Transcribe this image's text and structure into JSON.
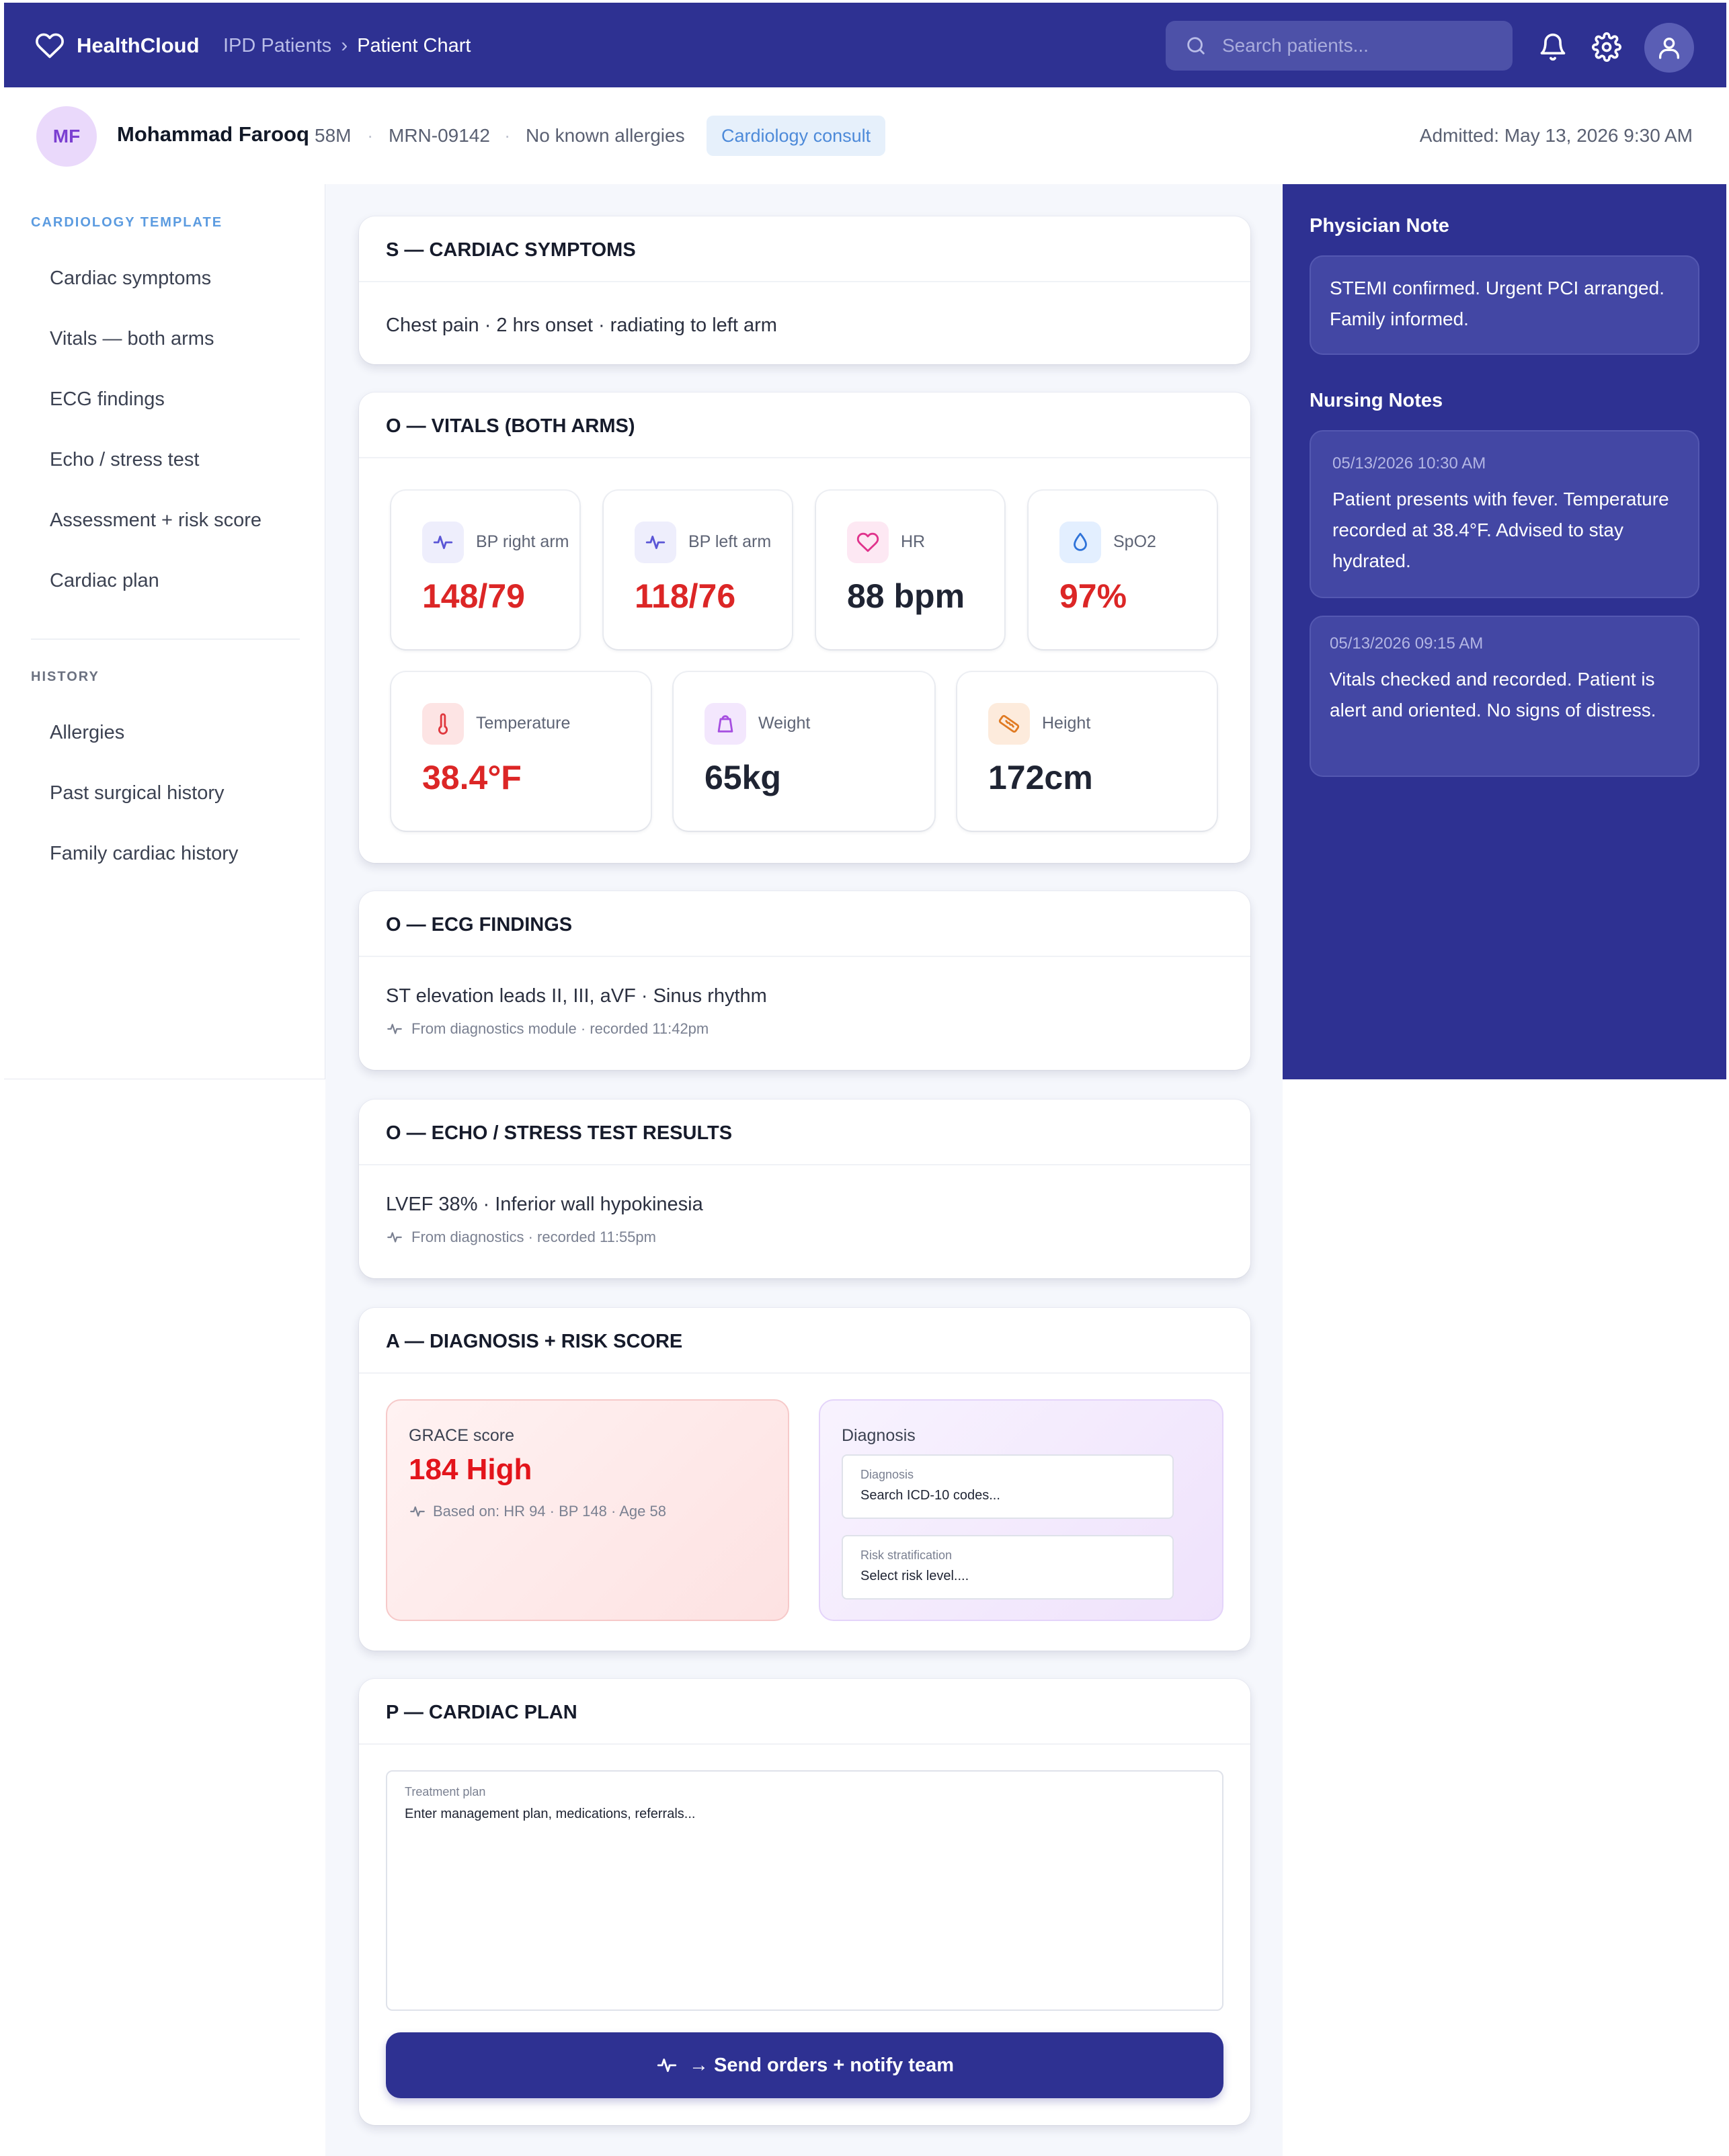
{
  "app": {
    "name": "HealthCloud",
    "breadcrumb": [
      "IPD Patients",
      "Patient Chart"
    ],
    "search_placeholder": "Search patients...",
    "brand_color": "#2e3192"
  },
  "patient": {
    "initials": "MF",
    "name": "Mohammad Farooq",
    "age_sex": "58M",
    "mrn": "MRN-09142",
    "allergies": "No known allergies",
    "consult_badge": "Cardiology consult",
    "admitted": "Admitted: May 13, 2026 9:30 AM"
  },
  "sidebar": {
    "template_heading": "CARDIOLOGY TEMPLATE",
    "template_items": [
      "Cardiac symptoms",
      "Vitals — both arms",
      "ECG findings",
      "Echo / stress test",
      "Assessment + risk score",
      "Cardiac plan"
    ],
    "history_heading": "HISTORY",
    "history_items": [
      "Allergies",
      "Past surgical history",
      "Family cardiac history"
    ]
  },
  "symptoms": {
    "title": "S — CARDIAC SYMPTOMS",
    "text": "Chest pain · 2 hrs onset · radiating to left arm"
  },
  "vitals": {
    "title": "O — VITALS (BOTH ARMS)",
    "items": [
      {
        "label": "BP right arm",
        "value": "148/79",
        "icon": "activity-icon",
        "color": "#dc2626"
      },
      {
        "label": "BP left arm",
        "value": "118/76",
        "icon": "activity-icon",
        "color": "#dc2626"
      },
      {
        "label": "HR",
        "value": "88 bpm",
        "icon": "heart-icon",
        "color": "#1f2433"
      },
      {
        "label": "SpO2",
        "value": "97%",
        "icon": "droplet-icon",
        "color": "#dc2626"
      },
      {
        "label": "Temperature",
        "value": "38.4°F",
        "icon": "thermometer-icon",
        "color": "#dc2626"
      },
      {
        "label": "Weight",
        "value": "65kg",
        "icon": "weight-icon",
        "color": "#1f2433"
      },
      {
        "label": "Height",
        "value": "172cm",
        "icon": "ruler-icon",
        "color": "#1f2433"
      }
    ]
  },
  "ecg": {
    "title": "O — ECG FINDINGS",
    "text": "ST elevation leads II, III, aVF · Sinus rhythm",
    "source": "From diagnostics module · recorded 11:42pm"
  },
  "echo": {
    "title": "O — ECHO / STRESS TEST RESULTS",
    "text": "LVEF 38% · Inferior wall hypokinesia",
    "source": "From diagnostics · recorded 11:55pm"
  },
  "assessment": {
    "title": "A — DIAGNOSIS + RISK SCORE",
    "grace_label": "GRACE score",
    "grace_value": "184 High",
    "grace_basis": "Based on: HR 94 · BP 148 · Age 58",
    "diagnosis_heading": "Diagnosis",
    "diagnosis_field_label": "Diagnosis",
    "diagnosis_field_value": "Search ICD-10 codes...",
    "risk_field_label": "Risk stratification",
    "risk_field_value": "Select risk level...."
  },
  "plan": {
    "title": "P — CARDIAC PLAN",
    "field_label": "Treatment plan",
    "field_value": "Enter management plan, medications, referrals...",
    "send_label": "→ Send orders + notify team"
  },
  "notes": {
    "physician_heading": "Physician Note",
    "physician_text": "STEMI confirmed. Urgent PCI arranged. Family informed.",
    "nursing_heading": "Nursing Notes",
    "nursing": [
      {
        "time": "05/13/2026 10:30 AM",
        "text": "Patient presents with fever. Temperature recorded at 38.4°F. Advised to stay hydrated."
      },
      {
        "time": "05/13/2026 09:15 AM",
        "text": "Vitals checked and recorded. Patient is alert and oriented. No signs of distress."
      }
    ]
  }
}
